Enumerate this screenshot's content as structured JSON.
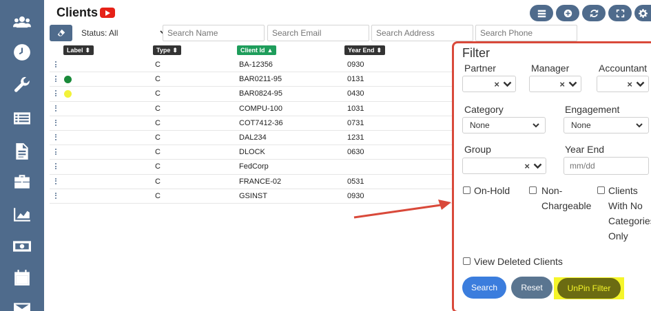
{
  "page": {
    "title": "Clients",
    "title_icon": "youtube-play-icon"
  },
  "sidebar": {
    "items": [
      {
        "icon": "users-icon"
      },
      {
        "icon": "clock-icon"
      },
      {
        "icon": "wrench-icon"
      },
      {
        "icon": "list-icon"
      },
      {
        "icon": "document-icon"
      },
      {
        "icon": "briefcase-icon"
      },
      {
        "icon": "chart-icon"
      },
      {
        "icon": "money-icon"
      },
      {
        "icon": "calendar-icon"
      },
      {
        "icon": "mail-icon"
      }
    ]
  },
  "toolbar": {
    "buttons": [
      "list-icon",
      "plus-icon",
      "refresh-icon",
      "expand-icon",
      "gear-icon"
    ]
  },
  "search": {
    "status_value": "Status: All",
    "name_placeholder": "Search Name",
    "email_placeholder": "Search Email",
    "address_placeholder": "Search Address",
    "phone_placeholder": "Search Phone"
  },
  "table": {
    "columns": {
      "label": "Label",
      "type": "Type",
      "client_id": "Client Id",
      "year_end": "Year End"
    },
    "sort_active": "client_id",
    "sort_direction": "asc",
    "rows": [
      {
        "dot": "",
        "type": "C",
        "client_id": "BA-12356",
        "year_end": "0930"
      },
      {
        "dot": "#1a8a3a",
        "type": "C",
        "client_id": "BAR0211-95",
        "year_end": "0131"
      },
      {
        "dot": "#f2f23a",
        "type": "C",
        "client_id": "BAR0824-95",
        "year_end": "0430"
      },
      {
        "dot": "",
        "type": "C",
        "client_id": "COMPU-100",
        "year_end": "1031"
      },
      {
        "dot": "",
        "type": "C",
        "client_id": "COT7412-36",
        "year_end": "0731"
      },
      {
        "dot": "",
        "type": "C",
        "client_id": "DAL234",
        "year_end": "1231"
      },
      {
        "dot": "",
        "type": "C",
        "client_id": "DLOCK",
        "year_end": "0630"
      },
      {
        "dot": "",
        "type": "C",
        "client_id": "FedCorp",
        "year_end": ""
      },
      {
        "dot": "",
        "type": "C",
        "client_id": "FRANCE-02",
        "year_end": "0531"
      },
      {
        "dot": "",
        "type": "C",
        "client_id": "GSINST",
        "year_end": "0930"
      }
    ]
  },
  "filter": {
    "title": "Filter",
    "partner_label": "Partner",
    "manager_label": "Manager",
    "accountant_label": "Accountant",
    "category_label": "Category",
    "category_value": "None",
    "engagement_label": "Engagement",
    "engagement_value": "None",
    "group_label": "Group",
    "year_end_label": "Year End",
    "year_end_placeholder": "mm/dd",
    "clear_symbol": "×",
    "on_hold_label": "On-Hold",
    "non_chargeable_line1": "Non-",
    "non_chargeable_line2": "Chargeable",
    "no_categories_line1": "Clients",
    "no_categories_line2": "With No",
    "no_categories_line3": "Categories",
    "no_categories_line4": "Only",
    "view_deleted_label": "View Deleted Clients",
    "search_button": "Search",
    "reset_button": "Reset",
    "unpin_button": "UnPin Filter"
  },
  "colors": {
    "sidebar": "#4f6b8c",
    "active_sort": "#1e9d5b",
    "panel_border": "#d9493a",
    "search_button": "#3b7ddd",
    "reset_button": "#5a7590",
    "unpin_button": "#6b6b12",
    "highlight": "#f5f52a",
    "arrow": "#d9493a"
  }
}
